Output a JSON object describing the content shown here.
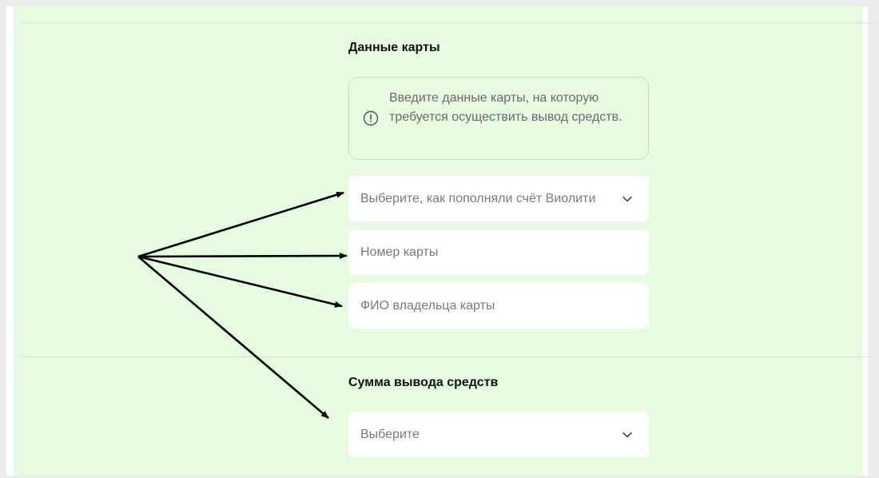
{
  "card_section": {
    "title": "Данные карты",
    "notice": {
      "icon": "info-circle-icon",
      "text": "Введите данные карты, на которую требуется осуществить вывод средств."
    },
    "fields": {
      "topup_method": {
        "placeholder": "Выберите, как пополняли счёт Виолити",
        "icon": "chevron-down-icon"
      },
      "card_number": {
        "placeholder": "Номер карты"
      },
      "card_holder": {
        "placeholder": "ФИО владельца карты"
      }
    }
  },
  "amount_section": {
    "title": "Сумма вывода средств",
    "select": {
      "placeholder": "Выберите",
      "icon": "chevron-down-icon"
    }
  },
  "colors": {
    "panel_background": "#e6fbe0",
    "field_background": "#ffffff",
    "annotation_arrow": "#000000"
  }
}
